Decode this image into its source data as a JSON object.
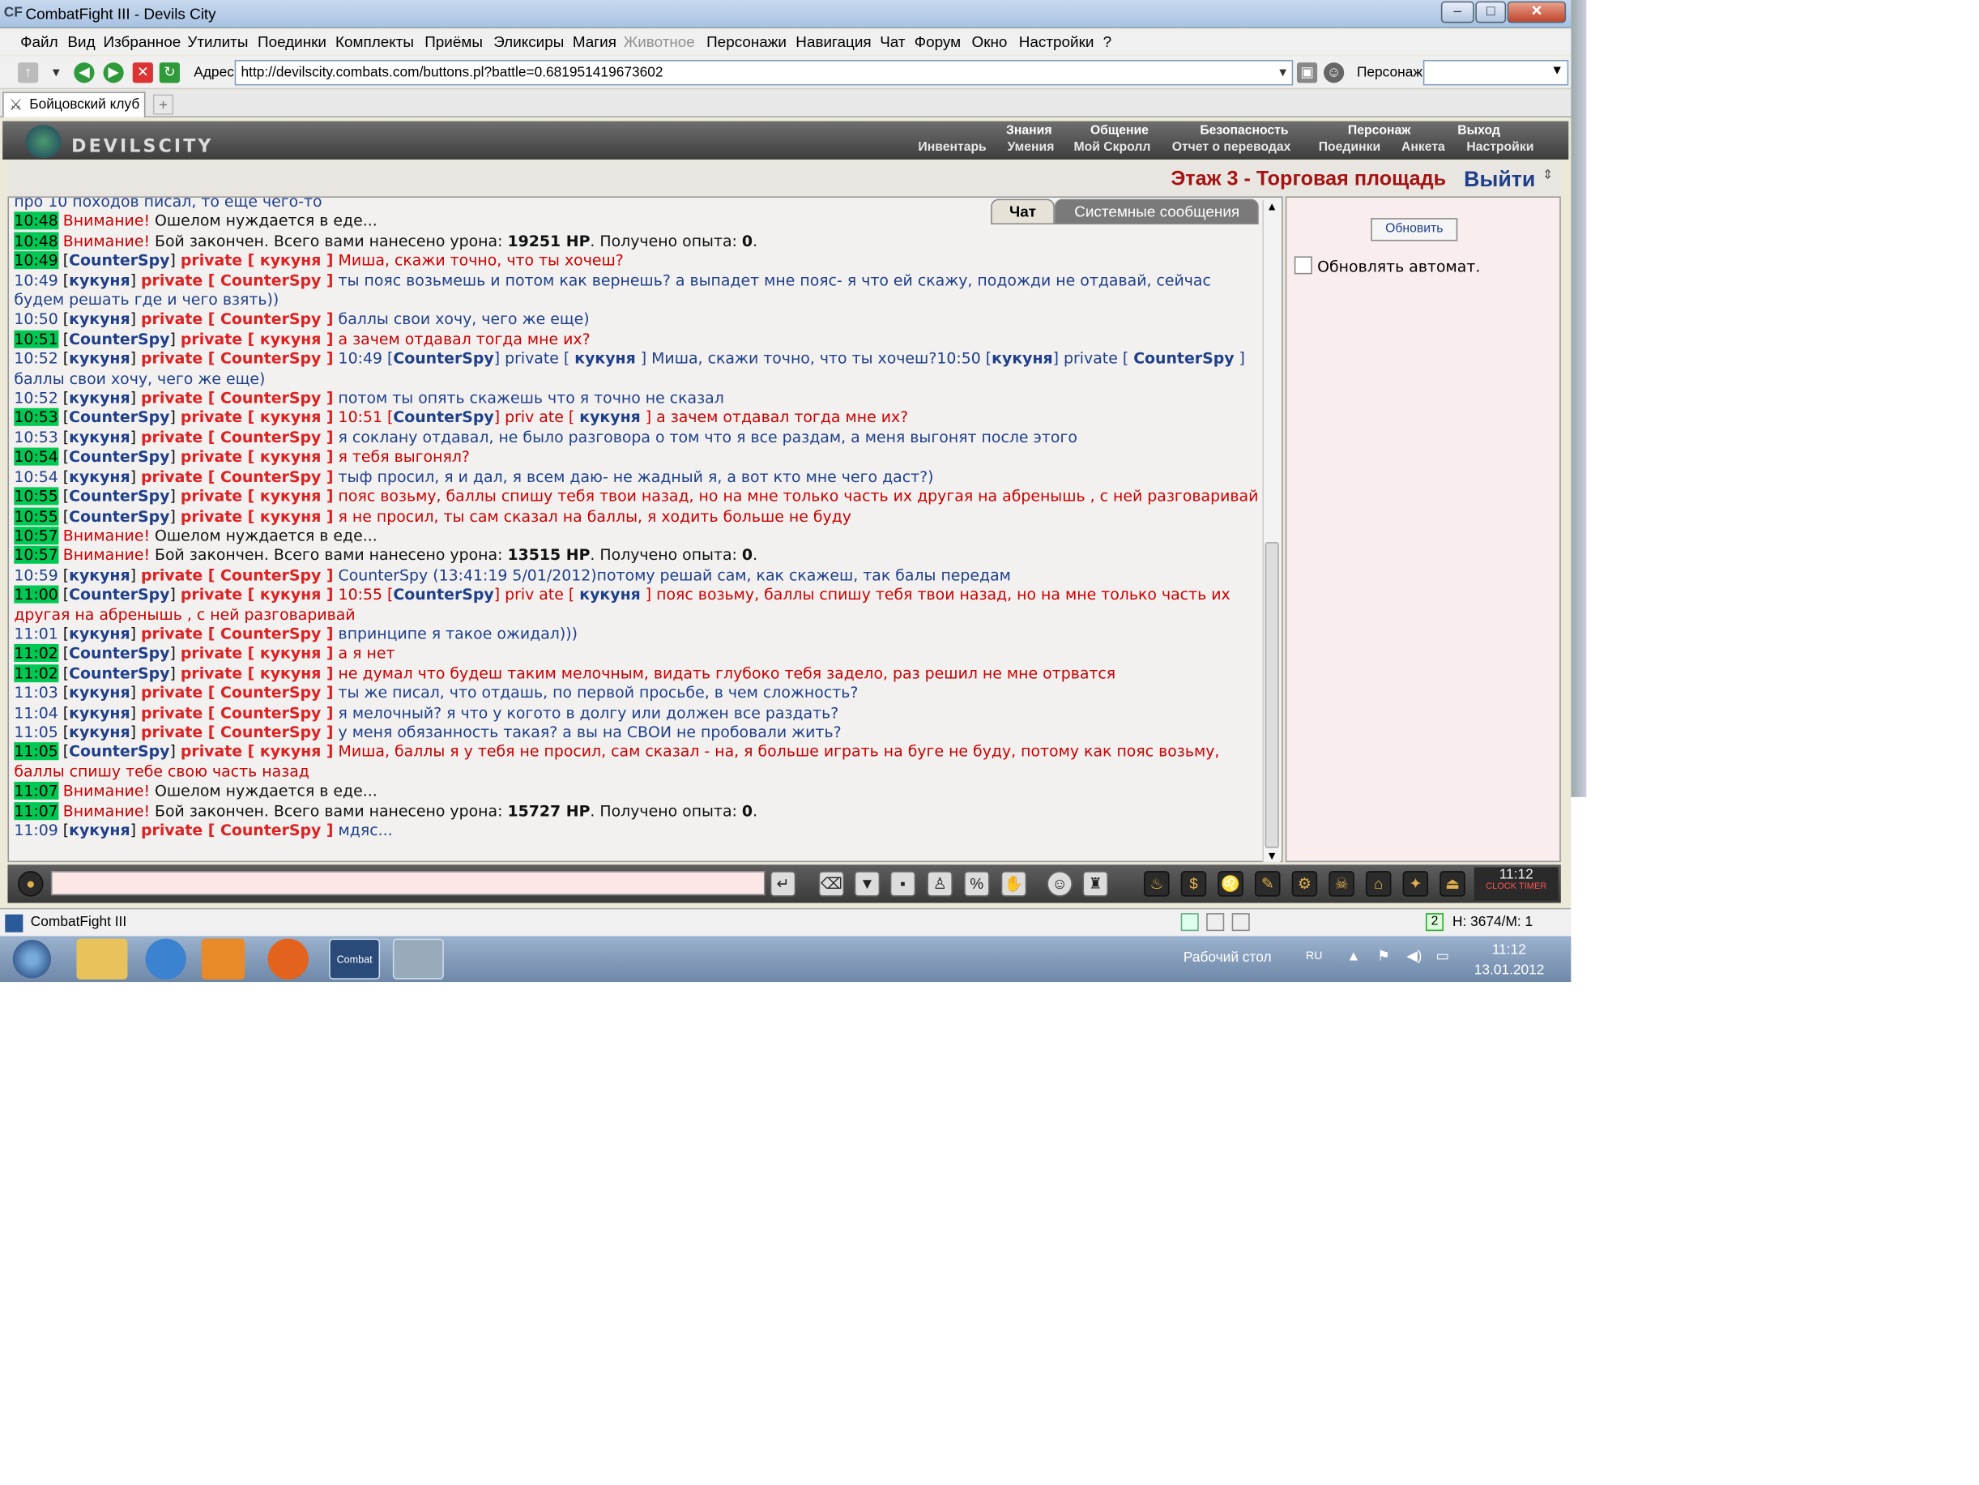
{
  "window": {
    "title": "CombatFight III - Devils City",
    "icon_text": "CF",
    "controls": [
      "–",
      "□",
      "✕"
    ]
  },
  "menu": {
    "items": [
      "Файл",
      "Вид",
      "Избранное",
      "Утилиты",
      "Поединки",
      "Комплекты",
      "Приёмы",
      "Эликсиры",
      "Магия",
      "Животное",
      "Персонажи",
      "Навигация",
      "Чат",
      "Форум",
      "Окно",
      "Настройки",
      "?"
    ],
    "disabled": [
      "Животное"
    ]
  },
  "address": {
    "label": "Адрес:",
    "url": "http://devilscity.combats.com/buttons.pl?battle=0.681951419673602",
    "person_label": "Персонаж:",
    "person_value": ""
  },
  "browser_tab": {
    "label": "Бойцовский клуб",
    "new_tab": "+"
  },
  "game": {
    "logo": "DEVILSCITY",
    "nav_top": [
      "Знания",
      "Общение",
      "Безопасность",
      "Персонаж",
      "Выход"
    ],
    "nav_sub": [
      "Инвентарь",
      "Умения",
      "Мой Скролл",
      "Отчет о переводах",
      "Поединки",
      "Анкета",
      "Настройки"
    ],
    "location": "Этаж 3 - Торговая площадь",
    "exit_label": "Выйти",
    "chat_tabs": [
      "Чат",
      "Системные сообщения"
    ],
    "refresh_button": "Обновить",
    "auto_refresh_label": "Обновлять автомат.",
    "clock": {
      "time": "11:12",
      "labels": [
        "CLOCK",
        "TIMER"
      ]
    }
  },
  "chat_lines": [
    [
      {
        "c": "blue",
        "t": "про 10 походов писал, то еще чего-то"
      }
    ],
    [
      {
        "c": "tg",
        "t": "10:48"
      },
      {
        "c": "red",
        "t": " Внимание!"
      },
      {
        "c": "blk",
        "t": " Ошелом нуждается в еде..."
      }
    ],
    [
      {
        "c": "tg",
        "t": "10:48"
      },
      {
        "c": "red",
        "t": " Внимание!"
      },
      {
        "c": "blk",
        "t": " Бой закончен. Всего вами нанесено урона: "
      },
      {
        "c": "blkb",
        "t": "19251 HP"
      },
      {
        "c": "blk",
        "t": ". Получено опыта: "
      },
      {
        "c": "blkb",
        "t": "0"
      },
      {
        "c": "blk",
        "t": "."
      }
    ],
    [
      {
        "c": "tg",
        "t": "10:49"
      },
      {
        "c": "blk",
        "t": " ["
      },
      {
        "c": "n",
        "t": "CounterSpy"
      },
      {
        "c": "blk",
        "t": "] "
      },
      {
        "c": "p",
        "t": "private [ кукуня ]"
      },
      {
        "c": "red",
        "t": " Миша, скажи точно, что ты хочеш?"
      }
    ],
    [
      {
        "c": "t",
        "t": "10:49"
      },
      {
        "c": "blk",
        "t": " ["
      },
      {
        "c": "n",
        "t": "кукуня"
      },
      {
        "c": "blk",
        "t": "] "
      },
      {
        "c": "p",
        "t": "private [ CounterSpy ]"
      },
      {
        "c": "blue",
        "t": " ты пояс возьмешь и потом как вернешь? а выпадет мне пояс- я что ей скажу, подожди не отдавай, сейчас будем решать где и чего взять))"
      }
    ],
    [
      {
        "c": "t",
        "t": "10:50"
      },
      {
        "c": "blk",
        "t": " ["
      },
      {
        "c": "n",
        "t": "кукуня"
      },
      {
        "c": "blk",
        "t": "] "
      },
      {
        "c": "p",
        "t": "private [ CounterSpy ]"
      },
      {
        "c": "blue",
        "t": " баллы свои хочу, чего же еще)"
      }
    ],
    [
      {
        "c": "tg",
        "t": "10:51"
      },
      {
        "c": "blk",
        "t": " ["
      },
      {
        "c": "n",
        "t": "CounterSpy"
      },
      {
        "c": "blk",
        "t": "] "
      },
      {
        "c": "p",
        "t": "private [ кукуня ]"
      },
      {
        "c": "red",
        "t": " а зачем отдавал тогда мне их?"
      }
    ],
    [
      {
        "c": "t",
        "t": "10:52"
      },
      {
        "c": "blk",
        "t": " ["
      },
      {
        "c": "n",
        "t": "кукуня"
      },
      {
        "c": "blk",
        "t": "] "
      },
      {
        "c": "p",
        "t": "private [ CounterSpy ]"
      },
      {
        "c": "blue",
        "t": " 10:49 ["
      },
      {
        "c": "n",
        "t": "CounterSpy"
      },
      {
        "c": "blue",
        "t": "] private [ "
      },
      {
        "c": "n",
        "t": "кукуня"
      },
      {
        "c": "blue",
        "t": " ] Миша, скажи точно, что ты хочеш?10:50 ["
      },
      {
        "c": "n",
        "t": "кукуня"
      },
      {
        "c": "blue",
        "t": "] private [ "
      },
      {
        "c": "n",
        "t": "CounterSpy"
      },
      {
        "c": "blue",
        "t": " ] баллы свои хочу, чего же еще)"
      }
    ],
    [
      {
        "c": "t",
        "t": "10:52"
      },
      {
        "c": "blk",
        "t": " ["
      },
      {
        "c": "n",
        "t": "кукуня"
      },
      {
        "c": "blk",
        "t": "] "
      },
      {
        "c": "p",
        "t": "private [ CounterSpy ]"
      },
      {
        "c": "blue",
        "t": " потом ты опять скажешь что я точно не сказал"
      }
    ],
    [
      {
        "c": "tg",
        "t": "10:53"
      },
      {
        "c": "blk",
        "t": " ["
      },
      {
        "c": "n",
        "t": "CounterSpy"
      },
      {
        "c": "blk",
        "t": "] "
      },
      {
        "c": "p",
        "t": "private [ кукуня ]"
      },
      {
        "c": "red",
        "t": " 10:51 ["
      },
      {
        "c": "n",
        "t": "CounterSpy"
      },
      {
        "c": "red",
        "t": "] priv ate [ "
      },
      {
        "c": "n",
        "t": "кукуня"
      },
      {
        "c": "red",
        "t": " ] а зачем отдавал тогда мне их?"
      }
    ],
    [
      {
        "c": "t",
        "t": "10:53"
      },
      {
        "c": "blk",
        "t": " ["
      },
      {
        "c": "n",
        "t": "кукуня"
      },
      {
        "c": "blk",
        "t": "] "
      },
      {
        "c": "p",
        "t": "private [ CounterSpy ]"
      },
      {
        "c": "blue",
        "t": " я соклану отдавал, не было разговора о том что я все раздам, а меня выгонят после этого"
      }
    ],
    [
      {
        "c": "tg",
        "t": "10:54"
      },
      {
        "c": "blk",
        "t": " ["
      },
      {
        "c": "n",
        "t": "CounterSpy"
      },
      {
        "c": "blk",
        "t": "] "
      },
      {
        "c": "p",
        "t": "private [ кукуня ]"
      },
      {
        "c": "red",
        "t": " я тебя выгонял?"
      }
    ],
    [
      {
        "c": "t",
        "t": "10:54"
      },
      {
        "c": "blk",
        "t": " ["
      },
      {
        "c": "n",
        "t": "кукуня"
      },
      {
        "c": "blk",
        "t": "] "
      },
      {
        "c": "p",
        "t": "private [ CounterSpy ]"
      },
      {
        "c": "blue",
        "t": " тыф просил, я и дал, я всем даю- не жадный я, а вот кто мне чего даст?)"
      }
    ],
    [
      {
        "c": "tg",
        "t": "10:55"
      },
      {
        "c": "blk",
        "t": " ["
      },
      {
        "c": "n",
        "t": "CounterSpy"
      },
      {
        "c": "blk",
        "t": "] "
      },
      {
        "c": "p",
        "t": "private [ кукуня ]"
      },
      {
        "c": "red",
        "t": " пояс возьму, баллы спишу тебя твои назад, но на мне только часть их другая на абренышь , с ней разговаривай"
      }
    ],
    [
      {
        "c": "tg",
        "t": "10:55"
      },
      {
        "c": "blk",
        "t": " ["
      },
      {
        "c": "n",
        "t": "CounterSpy"
      },
      {
        "c": "blk",
        "t": "] "
      },
      {
        "c": "p",
        "t": "private [ кукуня ]"
      },
      {
        "c": "red",
        "t": " я не просил, ты сам сказал на баллы, я ходить больше не буду"
      }
    ],
    [
      {
        "c": "tg",
        "t": "10:57"
      },
      {
        "c": "red",
        "t": " Внимание!"
      },
      {
        "c": "blk",
        "t": " Ошелом нуждается в еде..."
      }
    ],
    [
      {
        "c": "tg",
        "t": "10:57"
      },
      {
        "c": "red",
        "t": " Внимание!"
      },
      {
        "c": "blk",
        "t": " Бой закончен. Всего вами нанесено урона: "
      },
      {
        "c": "blkb",
        "t": "13515 HP"
      },
      {
        "c": "blk",
        "t": ". Получено опыта: "
      },
      {
        "c": "blkb",
        "t": "0"
      },
      {
        "c": "blk",
        "t": "."
      }
    ],
    [
      {
        "c": "t",
        "t": "10:59"
      },
      {
        "c": "blk",
        "t": " ["
      },
      {
        "c": "n",
        "t": "кукуня"
      },
      {
        "c": "blk",
        "t": "] "
      },
      {
        "c": "p",
        "t": "private [ CounterSpy ]"
      },
      {
        "c": "blue",
        "t": " CounterSpy (13:41:19 5/01/2012)потому решай сам, как скажеш, так балы передам"
      }
    ],
    [
      {
        "c": "tg",
        "t": "11:00"
      },
      {
        "c": "blk",
        "t": " ["
      },
      {
        "c": "n",
        "t": "CounterSpy"
      },
      {
        "c": "blk",
        "t": "] "
      },
      {
        "c": "p",
        "t": "private [ кукуня ]"
      },
      {
        "c": "red",
        "t": " 10:55 ["
      },
      {
        "c": "n",
        "t": "CounterSpy"
      },
      {
        "c": "red",
        "t": "] priv ate [ "
      },
      {
        "c": "n",
        "t": "кукуня"
      },
      {
        "c": "red",
        "t": " ] пояс возьму, баллы спишу тебя твои назад, но на мне только часть их другая на абренышь , с ней разговаривай"
      }
    ],
    [
      {
        "c": "t",
        "t": "11:01"
      },
      {
        "c": "blk",
        "t": " ["
      },
      {
        "c": "n",
        "t": "кукуня"
      },
      {
        "c": "blk",
        "t": "] "
      },
      {
        "c": "p",
        "t": "private [ CounterSpy ]"
      },
      {
        "c": "blue",
        "t": " впринципе я такое ожидал)))"
      }
    ],
    [
      {
        "c": "tg",
        "t": "11:02"
      },
      {
        "c": "blk",
        "t": " ["
      },
      {
        "c": "n",
        "t": "CounterSpy"
      },
      {
        "c": "blk",
        "t": "] "
      },
      {
        "c": "p",
        "t": "private [ кукуня ]"
      },
      {
        "c": "red",
        "t": " а я нет"
      }
    ],
    [
      {
        "c": "tg",
        "t": "11:02"
      },
      {
        "c": "blk",
        "t": " ["
      },
      {
        "c": "n",
        "t": "CounterSpy"
      },
      {
        "c": "blk",
        "t": "] "
      },
      {
        "c": "p",
        "t": "private [ кукуня ]"
      },
      {
        "c": "red",
        "t": " не думал что будеш таким мелочным, видать глубоко тебя задело, раз решил не мне отрватся"
      }
    ],
    [
      {
        "c": "t",
        "t": "11:03"
      },
      {
        "c": "blk",
        "t": " ["
      },
      {
        "c": "n",
        "t": "кукуня"
      },
      {
        "c": "blk",
        "t": "] "
      },
      {
        "c": "p",
        "t": "private [ CounterSpy ]"
      },
      {
        "c": "blue",
        "t": " ты же писал, что отдашь, по первой просьбе, в чем сложность?"
      }
    ],
    [
      {
        "c": "t",
        "t": "11:04"
      },
      {
        "c": "blk",
        "t": " ["
      },
      {
        "c": "n",
        "t": "кукуня"
      },
      {
        "c": "blk",
        "t": "] "
      },
      {
        "c": "p",
        "t": "private [ CounterSpy ]"
      },
      {
        "c": "blue",
        "t": " я мелочный? я что у когото в долгу или должен все раздать?"
      }
    ],
    [
      {
        "c": "t",
        "t": "11:05"
      },
      {
        "c": "blk",
        "t": " ["
      },
      {
        "c": "n",
        "t": "кукуня"
      },
      {
        "c": "blk",
        "t": "] "
      },
      {
        "c": "p",
        "t": "private [ CounterSpy ]"
      },
      {
        "c": "blue",
        "t": " у меня обязанность такая? а вы на СВОИ не пробовали жить?"
      }
    ],
    [
      {
        "c": "tg",
        "t": "11:05"
      },
      {
        "c": "blk",
        "t": " ["
      },
      {
        "c": "n",
        "t": "CounterSpy"
      },
      {
        "c": "blk",
        "t": "] "
      },
      {
        "c": "p",
        "t": "private [ кукуня ]"
      },
      {
        "c": "red",
        "t": " Миша, баллы я у тебя не просил, сам сказал - на, я больше играть на буге не буду, потому как пояс возьму, баллы спишу тебе свою часть назад"
      }
    ],
    [
      {
        "c": "tg",
        "t": "11:07"
      },
      {
        "c": "red",
        "t": " Внимание!"
      },
      {
        "c": "blk",
        "t": " Ошелом нуждается в еде..."
      }
    ],
    [
      {
        "c": "tg",
        "t": "11:07"
      },
      {
        "c": "red",
        "t": " Внимание!"
      },
      {
        "c": "blk",
        "t": " Бой закончен. Всего вами нанесено урона: "
      },
      {
        "c": "blkb",
        "t": "15727 HP"
      },
      {
        "c": "blk",
        "t": ". Получено опыта: "
      },
      {
        "c": "blkb",
        "t": "0"
      },
      {
        "c": "blk",
        "t": "."
      }
    ],
    [
      {
        "c": "t",
        "t": "11:09"
      },
      {
        "c": "blk",
        "t": " ["
      },
      {
        "c": "n",
        "t": "кукуня"
      },
      {
        "c": "blk",
        "t": "] "
      },
      {
        "c": "p",
        "t": "private [ CounterSpy ]"
      },
      {
        "c": "blue",
        "t": " мдяс..."
      }
    ]
  ],
  "statusbar": {
    "app": "CombatFight III",
    "hp": "H: 3674/M: 1"
  },
  "taskbar": {
    "desktop": "Рабочий стол",
    "lang": "RU",
    "time": "11:12",
    "date": "13.01.2012",
    "app_label": "Combat Fight III"
  },
  "colors": {
    "accent_red": "#a51212",
    "link_blue": "#1f3f8a",
    "private_red": "#e02020",
    "time_green": "#00c853"
  }
}
